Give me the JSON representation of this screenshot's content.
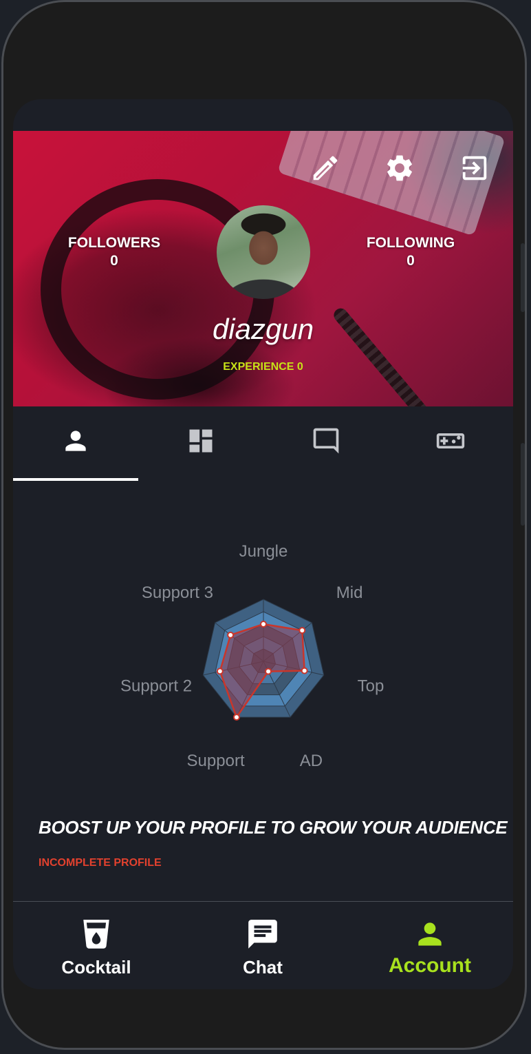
{
  "profile": {
    "followers_label": "FOLLOWERS",
    "followers_count": "0",
    "following_label": "FOLLOWING",
    "following_count": "0",
    "username": "diazgun",
    "experience": "EXPERIENCE 0"
  },
  "hero_actions": [
    "edit-icon",
    "settings-icon",
    "logout-icon"
  ],
  "tabs": [
    {
      "icon": "person-icon",
      "active": true
    },
    {
      "icon": "dashboard-icon",
      "active": false
    },
    {
      "icon": "chat-bubble-icon",
      "active": false
    },
    {
      "icon": "gamepad-icon",
      "active": false
    }
  ],
  "chart_data": {
    "type": "radar",
    "axes": [
      "Jungle",
      "Mid",
      "Top",
      "AD",
      "Support",
      "Support 2",
      "Support 3"
    ],
    "rings": 5,
    "range": [
      0,
      5
    ],
    "series": [
      {
        "values": [
          3,
          4,
          3.4,
          0.9,
          5,
          3.6,
          3.4
        ],
        "color": "#c9362b"
      }
    ]
  },
  "cta": {
    "title": "BOOST UP YOUR PROFILE TO GROW YOUR AUDIENCE",
    "status": "INCOMPLETE PROFILE"
  },
  "bottom_nav": [
    {
      "label": "Cocktail",
      "icon": "cocktail-icon",
      "active": false
    },
    {
      "label": "Chat",
      "icon": "chat-icon",
      "active": false
    },
    {
      "label": "Account",
      "icon": "account-icon",
      "active": true
    }
  ],
  "colors": {
    "accent": "#a8e11e",
    "warning": "#e2412e",
    "experience": "#c7e218"
  }
}
